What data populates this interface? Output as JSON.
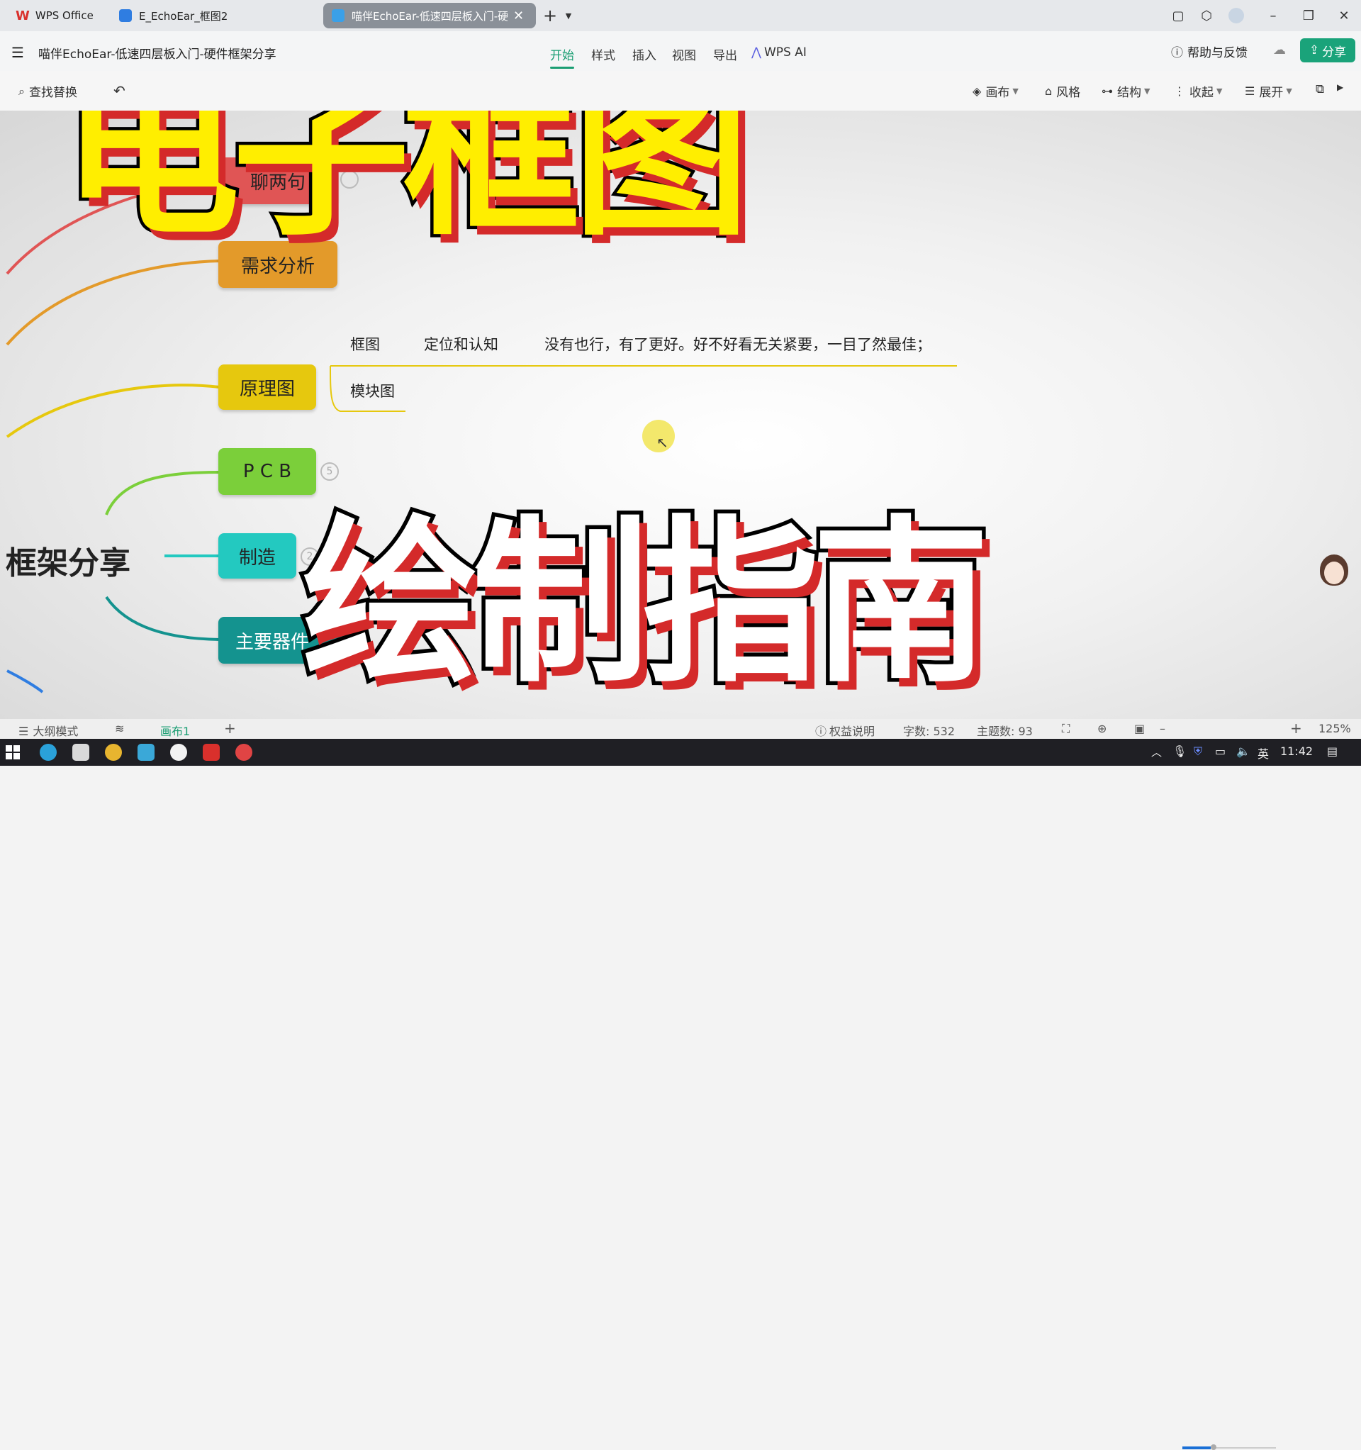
{
  "titlebar": {
    "tabs": [
      {
        "label": "WPS Office",
        "active": false
      },
      {
        "label": "E_EchoEar_框图2",
        "active": false
      },
      {
        "label": "喵伴EchoEar-低速四层板入门-硬",
        "active": true
      }
    ],
    "new_tab": "+",
    "colors": {
      "wps_red": "#d9302c",
      "doc_blue": "#2f7de1",
      "active_tab": "#8a9098"
    }
  },
  "menubar": {
    "doc_title": "喵伴EchoEar-低速四层板入门-硬件框架分享",
    "menus": [
      "开始",
      "样式",
      "插入",
      "视图",
      "导出",
      "WPS AI"
    ],
    "active_menu": "开始",
    "help": "帮助与反馈",
    "share": "分享",
    "colors": {
      "accent": "#1a9e73",
      "share_bg": "#1aa37a"
    }
  },
  "toolbar": {
    "find_replace": "查找替换",
    "canvas": "画布",
    "style": "风格",
    "structure": "结构",
    "collapse": "收起",
    "expand": "展开"
  },
  "mindmap": {
    "root_label": "框架分享",
    "nodes": [
      {
        "label": "聊两句",
        "color": "#e05555"
      },
      {
        "label": "需求分析",
        "color": "#e39a2a"
      },
      {
        "label": "原理图",
        "color": "#e6c80e"
      },
      {
        "label": "P C B",
        "color": "#7bcf3a",
        "count": "5"
      },
      {
        "label": "制造",
        "color": "#23c9c0",
        "count": "2"
      },
      {
        "label": "主要器件",
        "color": "#14938f"
      }
    ],
    "leaves": {
      "kuangtu": "框图",
      "dingwei": "定位和认知",
      "note": "没有也行，有了更好。好不好看无关紧要，一目了然最佳；",
      "mokuaitu": "模块图"
    }
  },
  "overlay": {
    "title_line1": "电子框图",
    "title_line2": "绘制指南",
    "colors": {
      "yellow": "#ffee00",
      "red_shadow": "#d42a2a",
      "white": "#ffffff"
    }
  },
  "statusbar": {
    "outline_mode": "大纲模式",
    "canvas_tab": "画布1",
    "rights": "权益说明",
    "word_count": "字数: 532",
    "topic_count": "主题数: 93",
    "zoom": "125%"
  },
  "taskbar": {
    "ime": "英",
    "time": "11:42"
  }
}
